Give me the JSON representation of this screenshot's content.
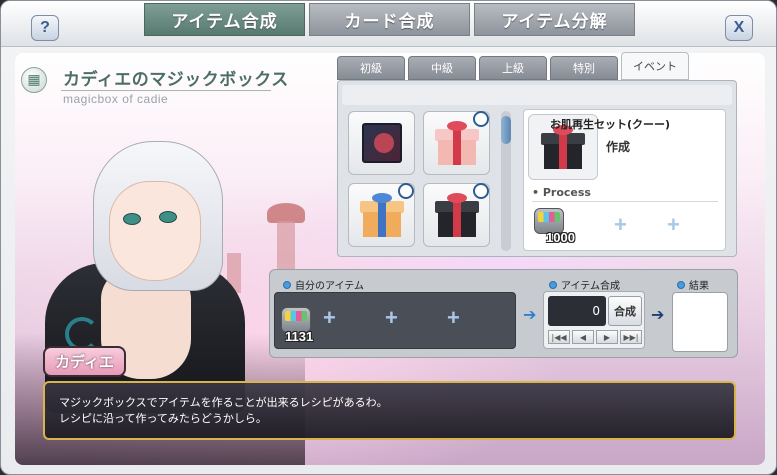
{
  "header": {
    "help_label": "?",
    "close_label": "X",
    "tabs": [
      {
        "label": "アイテム合成",
        "active": true
      },
      {
        "label": "カード合成",
        "active": false
      },
      {
        "label": "アイテム分解",
        "active": false
      }
    ]
  },
  "character": {
    "title": "カディエのマジックボックス",
    "subtitle": "magicbox of cadie",
    "speaker": "カディエ",
    "dialog_line1": "マジックボックスでアイテムを作ることが出来るレシピがあるわ。",
    "dialog_line2": "レシピに沿って作ってみたらどうかしら。"
  },
  "categories": [
    {
      "label": "初級",
      "active": false
    },
    {
      "label": "中級",
      "active": false
    },
    {
      "label": "上級",
      "active": false
    },
    {
      "label": "特別",
      "active": false
    },
    {
      "label": "イベント",
      "active": true
    }
  ],
  "recipes": [
    {
      "icon": "dark-emblem-icon",
      "timed": false
    },
    {
      "icon": "red-ribbon-gift-icon",
      "timed": true
    },
    {
      "icon": "blue-ribbon-gift-icon",
      "timed": true
    },
    {
      "icon": "black-gift-box-icon",
      "timed": true
    }
  ],
  "detail": {
    "item_name": "お肌再生セット(クーー)",
    "make_label": "作成",
    "process_label": "• Process",
    "process_item_count": "1000"
  },
  "craft": {
    "my_items_label": "自分のアイテム",
    "my_item_count": "1131",
    "craft_label": "アイテム合成",
    "quantity": "0",
    "craft_button": "合成",
    "result_label": "結果",
    "nav": [
      "|◀◀",
      "◀",
      "▶",
      "▶▶|"
    ]
  },
  "colors": {
    "active_tab": "#577a70",
    "dialog_border": "#d9b44a",
    "speaker_badge": "#e79ab8",
    "plus_slot": "#a9c7e6"
  }
}
